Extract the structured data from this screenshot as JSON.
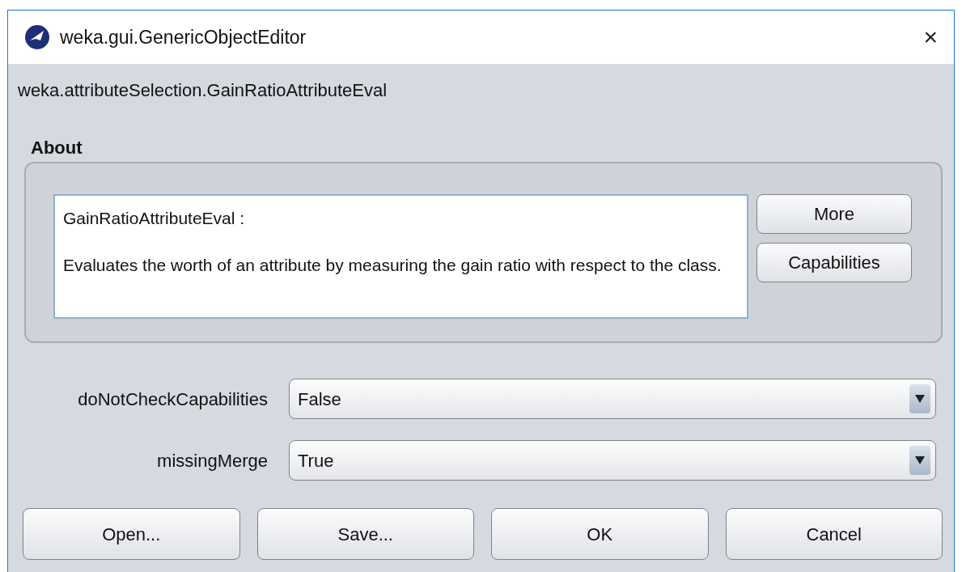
{
  "window": {
    "title": "weka.gui.GenericObjectEditor",
    "close": "×"
  },
  "class_name": "weka.attributeSelection.GainRatioAttributeEval",
  "about": {
    "heading": "About",
    "title": "GainRatioAttributeEval :",
    "description": "Evaluates the worth of an attribute by measuring the gain ratio with respect to the class.",
    "buttons": [
      "More",
      "Capabilities"
    ]
  },
  "properties": [
    {
      "label": "doNotCheckCapabilities",
      "value": "False"
    },
    {
      "label": "missingMerge",
      "value": "True"
    }
  ],
  "buttons": [
    "Open...",
    "Save...",
    "OK",
    "Cancel"
  ]
}
